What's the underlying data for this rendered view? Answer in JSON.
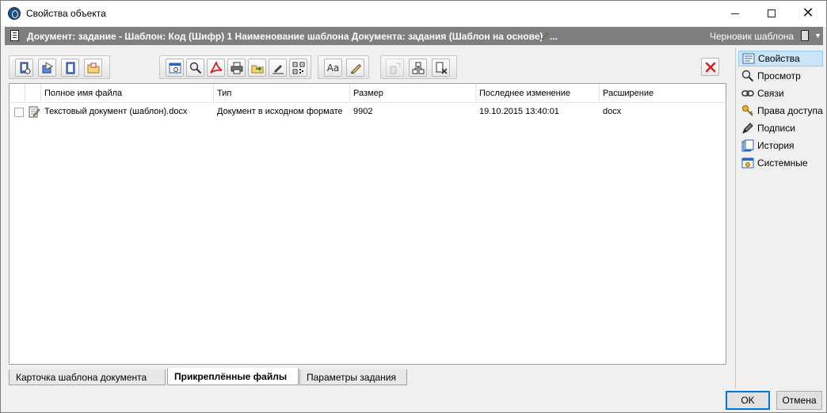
{
  "window": {
    "title": "Свойства объекта"
  },
  "docbar": {
    "title": "Документ: задание - Шаблон: Код (Шифр) 1  Наименование шаблона Документа: задания (Шаблон на основе)",
    "ellipsis": "...",
    "status": "Черновик шаблона"
  },
  "toolbar": {
    "font_label": "Aa"
  },
  "table": {
    "columns": [
      "Полное имя файла",
      "Тип",
      "Размер",
      "Последнее изменение",
      "Расширение"
    ],
    "rows": [
      [
        "Текстовый документ (шаблон).docx",
        "Документ в исходном формате",
        "9902",
        "19.10.2015 13:40:01",
        "docx"
      ]
    ]
  },
  "tabs": [
    "Карточка шаблона документа",
    "Прикреплённые файлы",
    "Параметры задания"
  ],
  "active_tab": "Прикреплённые файлы",
  "nav": {
    "items": [
      {
        "label": "Свойства",
        "icon": "properties-icon"
      },
      {
        "label": "Просмотр",
        "icon": "magnifier-icon"
      },
      {
        "label": "Связи",
        "icon": "link-icon"
      },
      {
        "label": "Права доступа",
        "icon": "key-icon"
      },
      {
        "label": "Подписи",
        "icon": "pen-icon"
      },
      {
        "label": "История",
        "icon": "history-icon"
      },
      {
        "label": "Системные",
        "icon": "system-icon"
      }
    ],
    "active": "Свойства"
  },
  "buttons": {
    "ok": "OK",
    "cancel": "Отмена"
  },
  "colors": {
    "docbar": "#7f7f7f",
    "selection": "#cce4f7",
    "delete_red": "#d42020"
  }
}
